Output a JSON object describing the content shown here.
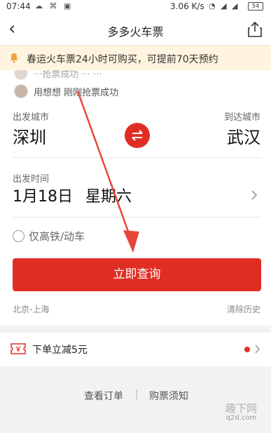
{
  "status_bar": {
    "time": "07:44",
    "speed": "3.06 K/s",
    "battery": "54"
  },
  "nav": {
    "back_glyph": "‹",
    "title": "多多火车票"
  },
  "notice": {
    "text": "春运火车票24小时可购买，可提前70天预约"
  },
  "ticker": {
    "row1": "···抢票成功 ··· ···",
    "row2": "用想想 刚刚抢票成功"
  },
  "form": {
    "depart_label": "出发城市",
    "depart_city": "深圳",
    "arrive_label": "到达城市",
    "arrive_city": "武汉",
    "date_label": "出发时间",
    "date": "1月18日",
    "weekday": "星期六",
    "hsr_only": "仅高铁/动车",
    "search_button": "立即查询",
    "history_route": "北京-上海",
    "clear_history": "清除历史"
  },
  "promo": {
    "text": "下单立减5元"
  },
  "footer": {
    "orders": "查看订单",
    "separator": "|",
    "purchase_notice": "购票须知"
  },
  "watermark": {
    "brand": "趣下网",
    "url": "q2d.com"
  },
  "colors": {
    "accent": "#e02e24",
    "notice_bg": "#fff4df",
    "arrow": "#e8463a"
  }
}
